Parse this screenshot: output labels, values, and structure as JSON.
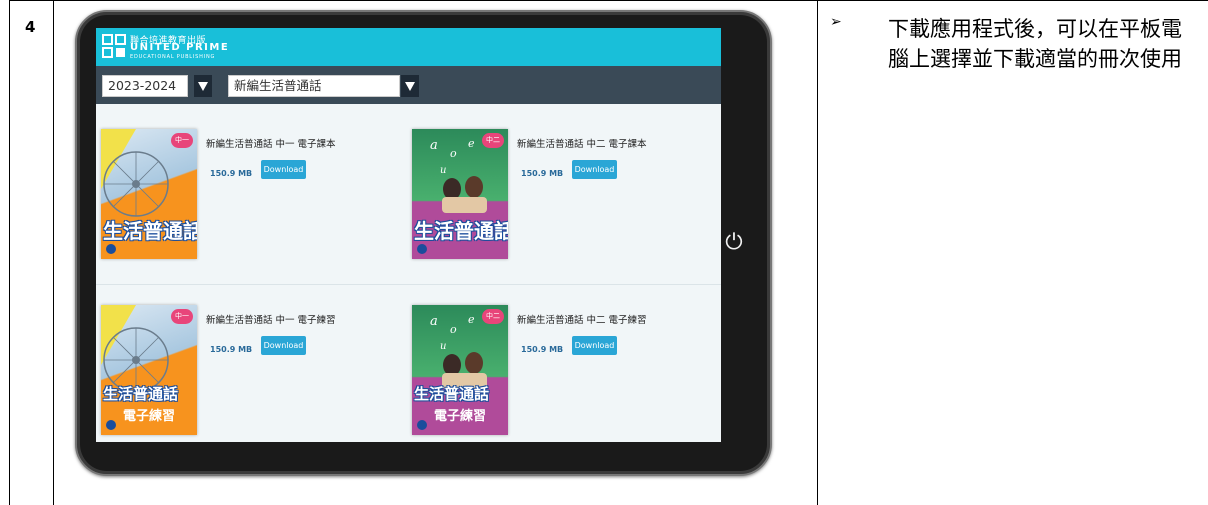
{
  "step": {
    "number": "4"
  },
  "note": {
    "bullet": "➢",
    "text": "下載應用程式後，可以在平板電腦上選擇並下載適當的冊次使用"
  },
  "app": {
    "logo": {
      "cn": "聯合培進教育出版",
      "en": "UNITED PRIME",
      "sub": "EDUCATIONAL PUBLISHING"
    },
    "filters": {
      "year": "2023-2024",
      "series": "新編生活普通話"
    },
    "colors": {
      "header": "#19bfd9",
      "filter_bar": "#3a4a57",
      "download": "#2aa6d6"
    },
    "books": [
      {
        "title": "新編生活普通話 中一 電子課本",
        "size": "150.9 MB",
        "action": "Download",
        "badge": "中一",
        "cover_title": "生活普通話",
        "cover_sub": ""
      },
      {
        "title": "新編生活普通話 中二 電子課本",
        "size": "150.9 MB",
        "action": "Download",
        "badge": "中二",
        "cover_title": "生活普通話",
        "cover_sub": ""
      },
      {
        "title": "新編生活普通話 中一 電子練習",
        "size": "150.9 MB",
        "action": "Download",
        "badge": "中一",
        "cover_title": "生活普通話",
        "cover_sub": "電子練習"
      },
      {
        "title": "新編生活普通話 中二 電子練習",
        "size": "150.9 MB",
        "action": "Download",
        "badge": "中二",
        "cover_title": "生活普通話",
        "cover_sub": "電子練習"
      }
    ]
  }
}
